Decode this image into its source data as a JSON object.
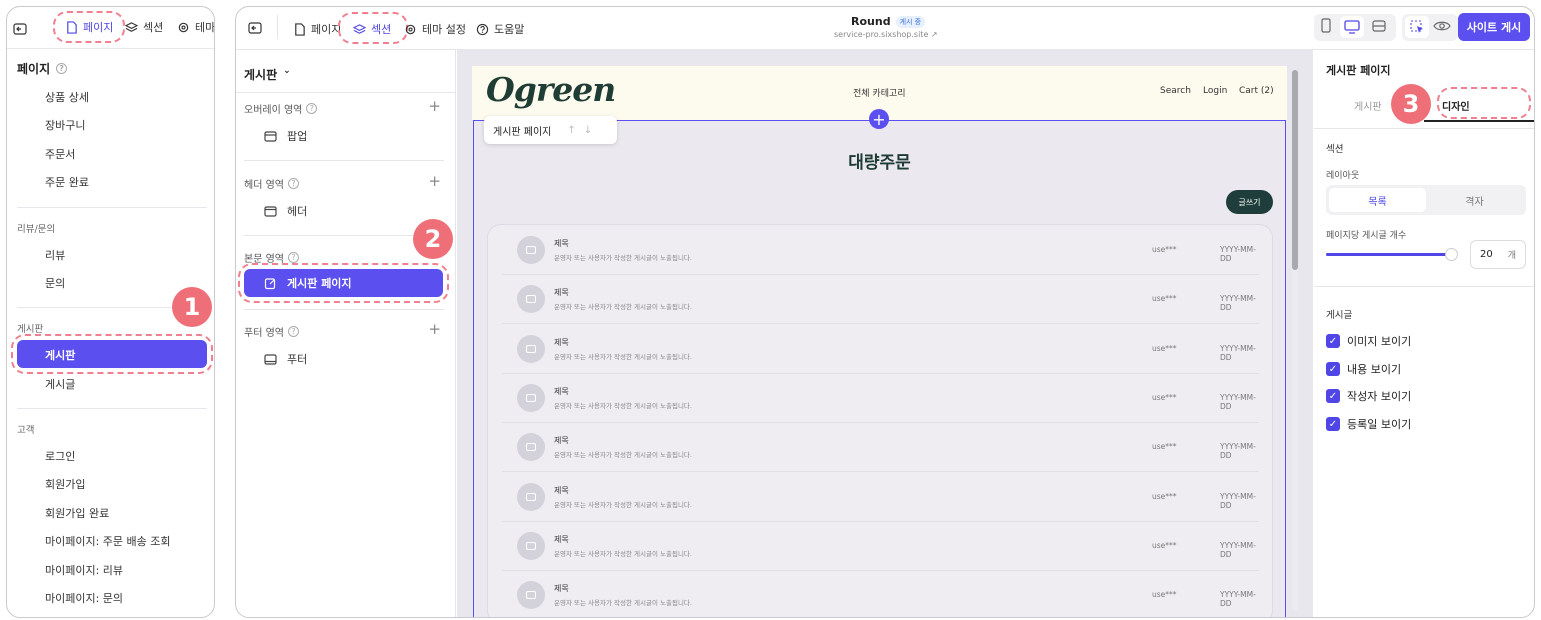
{
  "left_panel": {
    "toolbar": {
      "pages": "페이지",
      "sections": "섹션",
      "theme": "테마"
    },
    "title": "페이지",
    "items_top": [
      "상품 상세",
      "장바구니",
      "주문서",
      "주문 완료"
    ],
    "group_review": "리뷰/문의",
    "review_items": [
      "리뷰",
      "문의"
    ],
    "group_board": "게시판",
    "board_selected": "게시판",
    "board_items": [
      "게시글"
    ],
    "group_customer": "고객",
    "customer_items": [
      "로그인",
      "회원가입",
      "회원가입 완료",
      "마이페이지: 주문 배송 조회",
      "마이페이지: 리뷰",
      "마이페이지: 문의"
    ]
  },
  "badges": {
    "one": "1",
    "two": "2",
    "three": "3"
  },
  "toolbar": {
    "pages": "페이지",
    "sections": "섹션",
    "theme_settings": "테마 설정",
    "help": "도움말",
    "site_name": "Round",
    "status": "게시 중",
    "site_url": "service-pro.sixshop.site",
    "publish": "사이트 게시"
  },
  "section_panel": {
    "header": "게시판",
    "groups": [
      {
        "label": "오버레이 영역",
        "item": "팝업"
      },
      {
        "label": "헤더 영역",
        "item": "헤더"
      },
      {
        "label": "본문 영역",
        "item": "게시판 페이지"
      },
      {
        "label": "푸터 영역",
        "item": "푸터"
      }
    ]
  },
  "preview": {
    "logo": "Ogreen",
    "nav_center": "전체 카테고리",
    "nav_right": [
      "Search",
      "Login",
      "Cart (2)"
    ],
    "section_chip": "게시판 페이지",
    "heading": "대량주문",
    "write_button": "글쓰기",
    "rows": [
      {
        "title": "제목",
        "desc": "운영자 또는 사용자가 작성한 게시글이 노출됩니다.",
        "user": "use***",
        "date": "YYYY-MM-DD"
      },
      {
        "title": "제목",
        "desc": "운영자 또는 사용자가 작성한 게시글이 노출됩니다.",
        "user": "use***",
        "date": "YYYY-MM-DD"
      },
      {
        "title": "제목",
        "desc": "운영자 또는 사용자가 작성한 게시글이 노출됩니다.",
        "user": "use***",
        "date": "YYYY-MM-DD"
      },
      {
        "title": "제목",
        "desc": "운영자 또는 사용자가 작성한 게시글이 노출됩니다.",
        "user": "use***",
        "date": "YYYY-MM-DD"
      },
      {
        "title": "제목",
        "desc": "운영자 또는 사용자가 작성한 게시글이 노출됩니다.",
        "user": "use***",
        "date": "YYYY-MM-DD"
      },
      {
        "title": "제목",
        "desc": "운영자 또는 사용자가 작성한 게시글이 노출됩니다.",
        "user": "use***",
        "date": "YYYY-MM-DD"
      },
      {
        "title": "제목",
        "desc": "운영자 또는 사용자가 작성한 게시글이 노출됩니다.",
        "user": "use***",
        "date": "YYYY-MM-DD"
      },
      {
        "title": "제목",
        "desc": "운영자 또는 사용자가 작성한 게시글이 노출됩니다.",
        "user": "use***",
        "date": "YYYY-MM-DD"
      }
    ]
  },
  "settings": {
    "title": "게시판 페이지",
    "tab_board": "게시판",
    "tab_design": "디자인",
    "section_label": "섹션",
    "layout_label": "레이아웃",
    "layout_list": "목록",
    "layout_grid": "격자",
    "per_page_label": "페이지당 게시글 개수",
    "per_page_value": "20",
    "per_page_unit": "개",
    "per_page_slider_fraction": 0.97,
    "posts_label": "게시글",
    "checks": [
      "이미지 보이기",
      "내용 보이기",
      "작성자 보이기",
      "등록일 보이기"
    ]
  },
  "colors": {
    "accent": "#5b4ff0",
    "highlight": "#f07f8f",
    "preview_bg": "#e9e7ee",
    "header_bg": "#fdfbee",
    "logo": "#1f3d34"
  }
}
